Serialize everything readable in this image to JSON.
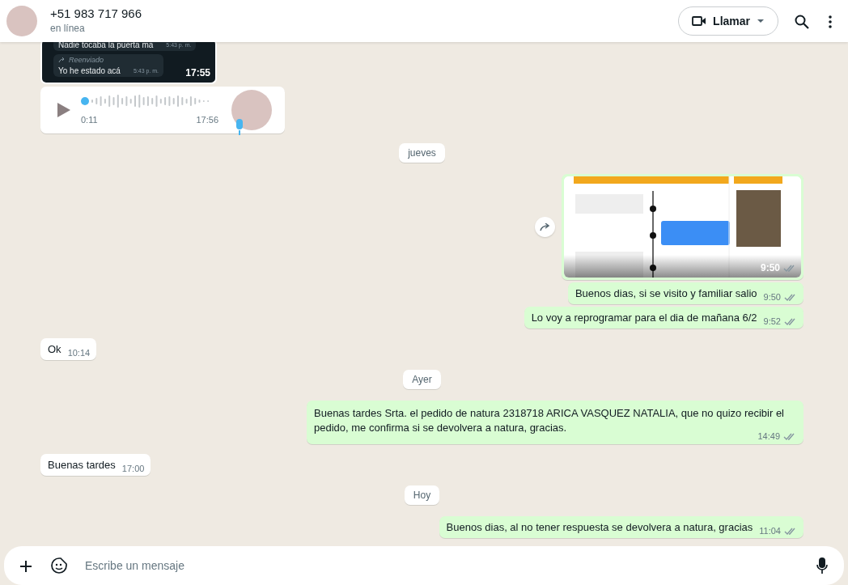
{
  "header": {
    "name": "+51 983 717 966",
    "status": "en línea",
    "call_button": "Llamar"
  },
  "messages": [
    {
      "kind": "forwarded-image",
      "outgoing": false,
      "lines": [
        {
          "text": "Nadie tocaba la puerta ma",
          "time": "5:43 p. m."
        },
        {
          "label": "Reenviado",
          "text": "Yo he estado acá",
          "time": "5:43 p. m."
        }
      ],
      "time": "17:55"
    },
    {
      "kind": "audio",
      "outgoing": false,
      "duration": "0:11",
      "time": "17:56"
    },
    {
      "kind": "date",
      "text": "jueves"
    },
    {
      "kind": "image",
      "outgoing": true,
      "time": "9:50",
      "read": false
    },
    {
      "kind": "text",
      "outgoing": true,
      "text": "Buenos dias, si se visito y familiar salio",
      "time": "9:50",
      "read": false
    },
    {
      "kind": "text",
      "outgoing": true,
      "text": "Lo voy a reprogramar para el dia de mañana 6/2",
      "time": "9:52",
      "read": false
    },
    {
      "kind": "text",
      "outgoing": false,
      "text": "Ok",
      "time": "10:14"
    },
    {
      "kind": "date",
      "text": "Ayer"
    },
    {
      "kind": "text",
      "outgoing": true,
      "text": "Buenas tardes Srta. el pedido de natura 2318718 ARICA VASQUEZ NATALIA, que no quizo recibir el pedido, me confirma si se devolvera a natura, gracias.",
      "time": "14:49",
      "read": false
    },
    {
      "kind": "text",
      "outgoing": false,
      "text": "Buenas tardes",
      "time": "17:00"
    },
    {
      "kind": "date",
      "text": "Hoy"
    },
    {
      "kind": "text",
      "outgoing": true,
      "text": "Buenos dias, al no tener respuesta se devolvera a natura, gracias",
      "time": "11:04",
      "read": false
    }
  ],
  "composer": {
    "placeholder": "Escribe un mensaje"
  }
}
